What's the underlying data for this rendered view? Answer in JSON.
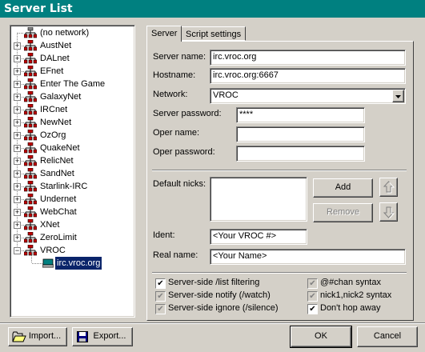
{
  "window": {
    "title": "Server List"
  },
  "tree": {
    "items": [
      {
        "label": "(no network)"
      },
      {
        "label": "AustNet"
      },
      {
        "label": "DALnet"
      },
      {
        "label": "EFnet"
      },
      {
        "label": "Enter The Game"
      },
      {
        "label": "GalaxyNet"
      },
      {
        "label": "IRCnet"
      },
      {
        "label": "NewNet"
      },
      {
        "label": "OzOrg"
      },
      {
        "label": "QuakeNet"
      },
      {
        "label": "RelicNet"
      },
      {
        "label": "SandNet"
      },
      {
        "label": "Starlink-IRC"
      },
      {
        "label": "Undernet"
      },
      {
        "label": "WebChat"
      },
      {
        "label": "XNet"
      },
      {
        "label": "ZeroLimit"
      },
      {
        "label": "VROC"
      }
    ],
    "child": {
      "label": "irc.vroc.org"
    },
    "expander_collapsed": "+",
    "expander_expanded": "−"
  },
  "tabs": {
    "server": "Server",
    "script": "Script settings"
  },
  "form": {
    "server_name_label": "Server name:",
    "server_name_value": "irc.vroc.org",
    "hostname_label": "Hostname:",
    "hostname_value": "irc.vroc.org:6667",
    "network_label": "Network:",
    "network_value": "VROC",
    "server_password_label": "Server password:",
    "server_password_value": "****",
    "oper_name_label": "Oper name:",
    "oper_name_value": "",
    "oper_password_label": "Oper password:",
    "oper_password_value": "",
    "default_nicks_label": "Default nicks:",
    "add_label": "Add",
    "remove_label": "Remove",
    "ident_label": "Ident:",
    "ident_value": "<Your VROC #>",
    "real_name_label": "Real name:",
    "real_name_value": "<Your Name>"
  },
  "checkboxes": [
    {
      "label": "Server-side /list filtering",
      "checked": true,
      "enabled": true
    },
    {
      "label": "Server-side notify (/watch)",
      "checked": true,
      "enabled": false
    },
    {
      "label": "Server-side ignore (/silence)",
      "checked": true,
      "enabled": false
    },
    {
      "label": "@#chan syntax",
      "checked": true,
      "enabled": false
    },
    {
      "label": "nick1,nick2 syntax",
      "checked": true,
      "enabled": false
    },
    {
      "label": "Don't hop away",
      "checked": true,
      "enabled": true
    }
  ],
  "check_mark": "✔",
  "buttons": {
    "import": "Import...",
    "export": "Export...",
    "ok": "OK",
    "cancel": "Cancel"
  },
  "colors": {
    "titlebar": "#008080",
    "face": "#d4d0c8",
    "selection": "#0a246a"
  }
}
